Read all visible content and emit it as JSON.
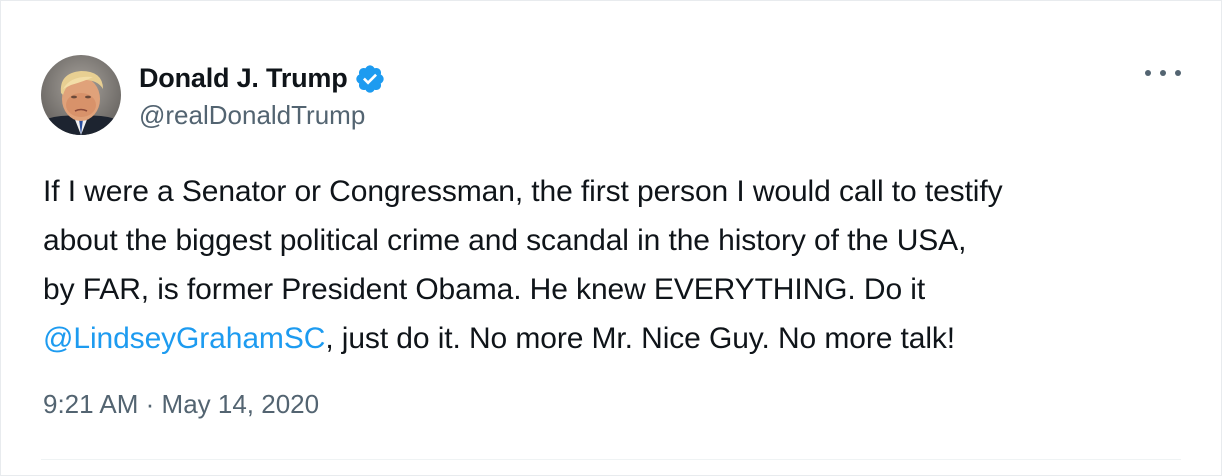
{
  "tweet": {
    "author": {
      "display_name": "Donald J. Trump",
      "handle": "@realDonaldTrump",
      "verified": true,
      "avatar_icon": "profile-photo"
    },
    "text": {
      "line1": "If I were a Senator or Congressman, the first person I would call to testify",
      "line2": "about the biggest political crime and scandal in the history of the USA,",
      "line3": "by FAR, is former President Obama. He knew EVERYTHING. Do it",
      "mention": "@LindseyGrahamSC",
      "line4_rest": ", just do it. No more Mr. Nice Guy. No more talk!"
    },
    "time": "9:21 AM",
    "separator": "·",
    "date": "May 14, 2020",
    "more_icon": "more-horizontal-icon"
  },
  "colors": {
    "text": "#0f1419",
    "secondary": "#536471",
    "accent": "#1d9bf0"
  }
}
